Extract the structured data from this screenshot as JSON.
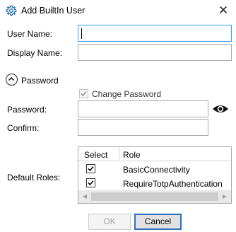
{
  "dialog": {
    "title": "Add BuiltIn User",
    "title_icon": "gear-icon",
    "close_glyph": "✕"
  },
  "fields": {
    "user_name_label": "User Name:",
    "user_name_value": "",
    "display_name_label": "Display Name:",
    "display_name_value": "",
    "password_section_label": "Password",
    "change_password_label": "Change Password",
    "change_password_checked": true,
    "password_label": "Password:",
    "password_value": "",
    "confirm_label": "Confirm:",
    "confirm_value": "",
    "default_roles_label": "Default Roles:"
  },
  "roles_grid": {
    "columns": [
      "Select",
      "Role"
    ],
    "rows": [
      {
        "selected": true,
        "role": "BasicConnectivity"
      },
      {
        "selected": true,
        "role": "RequireTotpAuthentication"
      }
    ]
  },
  "buttons": {
    "ok_label": "OK",
    "cancel_label": "Cancel"
  },
  "colors": {
    "focus_border": "#3399ff",
    "default_button_border": "#2f72c4"
  }
}
